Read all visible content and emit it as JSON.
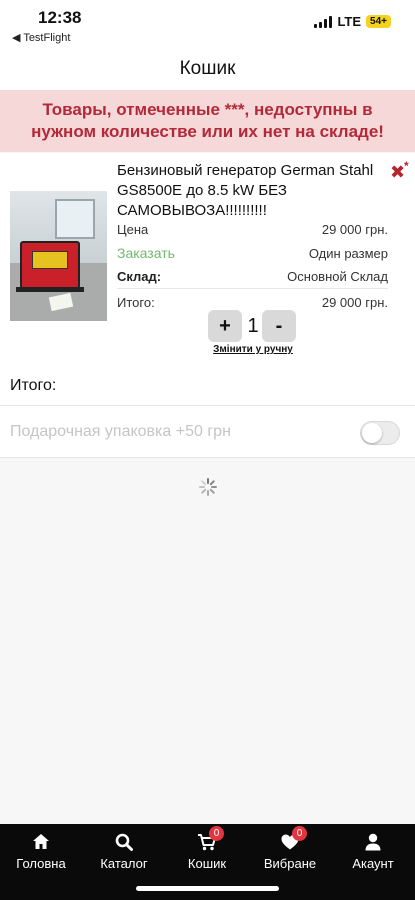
{
  "status_bar": {
    "time": "12:38",
    "back_app": "◀ TestFlight",
    "network": "LTE",
    "battery": "54+"
  },
  "header": {
    "title": "Кошик"
  },
  "warning": {
    "text": "Товары, отмеченные ***, недоступны в нужном количестве или их нет на складе!"
  },
  "cart_item": {
    "title": "Бензиновый генератор German Stahl GS8500E до 8.5 kW    БЕЗ САМОВЫВОЗА!!!!!!!!!!",
    "remove_icon": "✖",
    "remove_mark": "*",
    "price_label": "Цена",
    "price_value": "29 000 грн.",
    "order_label": "Заказать",
    "size_value": "Один размер",
    "stock_label": "Склад:",
    "stock_value": "Основной Склад",
    "total_label": "Итого:",
    "total_value": "29 000 грн.",
    "qty_plus": "+",
    "qty_value": "1",
    "qty_minus": "-",
    "change_manual": "Змінити у ручну"
  },
  "summary": {
    "total_label": "Итого:"
  },
  "gift": {
    "label": "Подарочная упаковка +50 грн",
    "enabled": false
  },
  "tab_bar": {
    "items": [
      {
        "label": "Головна",
        "icon": "home-icon"
      },
      {
        "label": "Каталог",
        "icon": "search-icon"
      },
      {
        "label": "Кошик",
        "icon": "cart-icon",
        "badge": "0"
      },
      {
        "label": "Вибране",
        "icon": "heart-icon",
        "badge": "0"
      },
      {
        "label": "Акаунт",
        "icon": "user-icon"
      }
    ]
  },
  "colors": {
    "warning_text": "#b2293a",
    "warning_bg": "#f6d8d8",
    "order_green": "#74b86f",
    "tab_bar_bg": "#0a0a0a",
    "badge_red": "#e3353f"
  }
}
